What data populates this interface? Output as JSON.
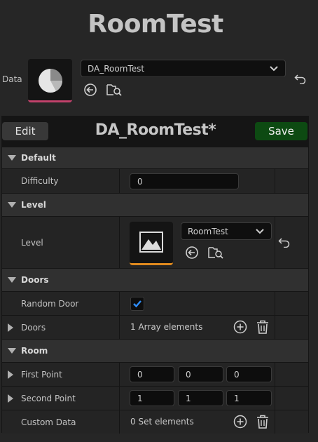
{
  "header": {
    "title": "RoomTest"
  },
  "data_row": {
    "label": "Data",
    "asset_value": "DA_RoomTest"
  },
  "toolbar": {
    "edit_label": "Edit",
    "asset_title": "DA_RoomTest*",
    "save_label": "Save"
  },
  "details": {
    "default": {
      "category": "Default",
      "difficulty_label": "Difficulty",
      "difficulty_value": "0"
    },
    "level": {
      "category": "Level",
      "level_label": "Level",
      "level_value": "RoomTest"
    },
    "doors": {
      "category": "Doors",
      "random_door_label": "Random Door",
      "random_door_checked": true,
      "doors_label": "Doors",
      "doors_value": "1 Array elements"
    },
    "room": {
      "category": "Room",
      "first_point_label": "First Point",
      "first_point": [
        "0",
        "0",
        "0"
      ],
      "second_point_label": "Second Point",
      "second_point": [
        "1",
        "1",
        "1"
      ],
      "custom_data_label": "Custom Data",
      "custom_data_value": "0 Set elements"
    }
  },
  "colors": {
    "save_button": "#0d4a12",
    "data_asset_underline": "#c2426b",
    "level_asset_underline": "#e08a1e",
    "checkbox_check": "#2f8fff"
  }
}
